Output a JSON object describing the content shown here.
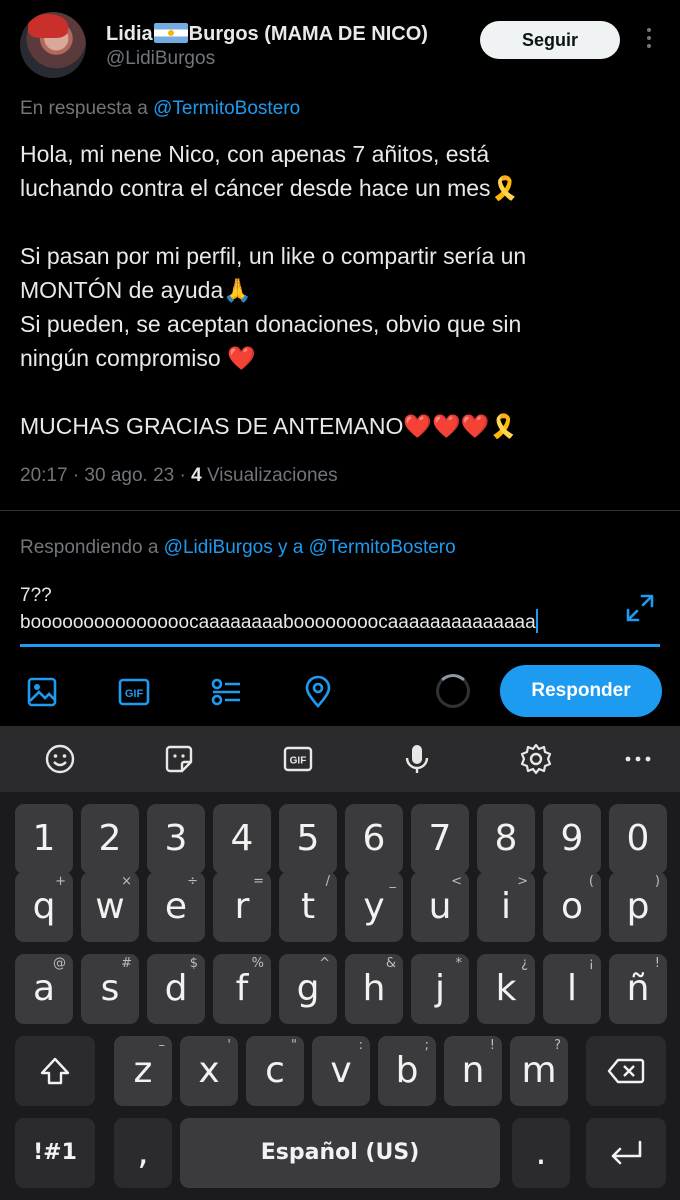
{
  "tweet": {
    "author_name_part1": "Lidia",
    "author_name_part2": "Burgos (MAMA DE NICO)",
    "flag_icon": "argentina-flag-icon",
    "handle": "@LidiBurgos",
    "follow_label": "Seguir",
    "reply_prefix": "En respuesta a ",
    "reply_mention": "@TermitoBostero",
    "text": "Hola,  mi nene Nico, con apenas 7 añitos, está\nluchando contra el cáncer desde hace un mes🎗️\n\nSi pasan por mi perfil, un like o compartir sería un\nMONTÓN de ayuda🙏\nSi pueden, se aceptan donaciones, obvio que sin\nningún compromiso ❤️\n\nMUCHAS GRACIAS DE ANTEMANO❤️❤️❤️🎗️",
    "time": "20:17 · 30 ago. 23 · ",
    "views_count": "4",
    "views_label": " Visualizaciones"
  },
  "composer": {
    "replying_prefix": "Respondiendo a ",
    "replying_mentions": "@LidiBurgos y a @TermitoBostero",
    "text": "7??\nbooooooooooooooocaaaaaaaaboooooooocaaaaaaaaaaaaaa",
    "reply_button": "Responder",
    "accent": "#1d9bf0"
  },
  "keyboard": {
    "toolbar": [
      "smiley-icon",
      "sticker-icon",
      "gif-icon",
      "microphone-icon",
      "settings-icon",
      "more-icon"
    ],
    "numbers": [
      "1",
      "2",
      "3",
      "4",
      "5",
      "6",
      "7",
      "8",
      "9",
      "0"
    ],
    "row1": [
      [
        "q",
        "+"
      ],
      [
        "w",
        "×"
      ],
      [
        "e",
        "÷"
      ],
      [
        "r",
        "="
      ],
      [
        "t",
        "/"
      ],
      [
        "y",
        "_"
      ],
      [
        "u",
        "<"
      ],
      [
        "i",
        ">"
      ],
      [
        "o",
        "("
      ],
      [
        "p",
        ")"
      ]
    ],
    "row2": [
      [
        "a",
        "@"
      ],
      [
        "s",
        "#"
      ],
      [
        "d",
        "$"
      ],
      [
        "f",
        "%"
      ],
      [
        "g",
        "^"
      ],
      [
        "h",
        "&"
      ],
      [
        "j",
        "*"
      ],
      [
        "k",
        "¿"
      ],
      [
        "l",
        "¡"
      ],
      [
        "ñ",
        "!"
      ]
    ],
    "row3": [
      [
        "z",
        "–"
      ],
      [
        "x",
        "'"
      ],
      [
        "c",
        "\""
      ],
      [
        "v",
        ":"
      ],
      [
        "b",
        ";"
      ],
      [
        "n",
        "!"
      ],
      [
        "m",
        "?"
      ]
    ],
    "symbols_key": "!#1",
    "comma_key": ",",
    "space_label": "Español (US)",
    "period_key": "."
  }
}
